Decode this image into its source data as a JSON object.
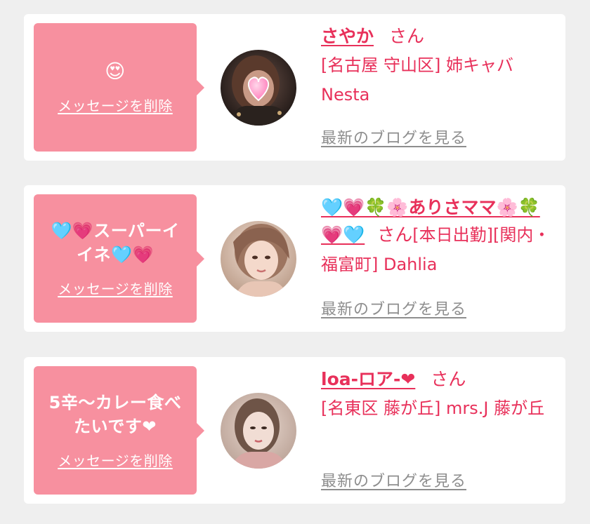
{
  "colors": {
    "page_bg": "#efefef",
    "card_bg": "#ffffff",
    "bubble_bg": "#f7909f",
    "accent": "#e8305a",
    "link_gray": "#8e8e8e"
  },
  "cards": [
    {
      "message": "😍",
      "delete_label": "メッセージを削除",
      "name": "さやか",
      "honorific": "さん",
      "shop": "[名古屋 守山区] 姉キャバ Nesta",
      "blog_label": "最新のブログを見る",
      "avatar_icon": "profile-photo-with-heart-sticker"
    },
    {
      "message": "🩵💗スーパーイイネ🩵💗",
      "delete_label": "メッセージを削除",
      "name": "🩵💗🍀🌸ありさママ🌸🍀💗🩵",
      "honorific": "さん",
      "shop": "[本日出勤][関内・福富町] Dahlia",
      "blog_label": "最新のブログを見る",
      "avatar_icon": "profile-photo"
    },
    {
      "message": "5辛〜カレー食べたいです❤",
      "delete_label": "メッセージを削除",
      "name": "loa-ロア-❤",
      "honorific": "さん",
      "shop": "[名東区 藤が丘] mrs.J 藤が丘",
      "blog_label": "最新のブログを見る",
      "avatar_icon": "profile-photo"
    }
  ]
}
